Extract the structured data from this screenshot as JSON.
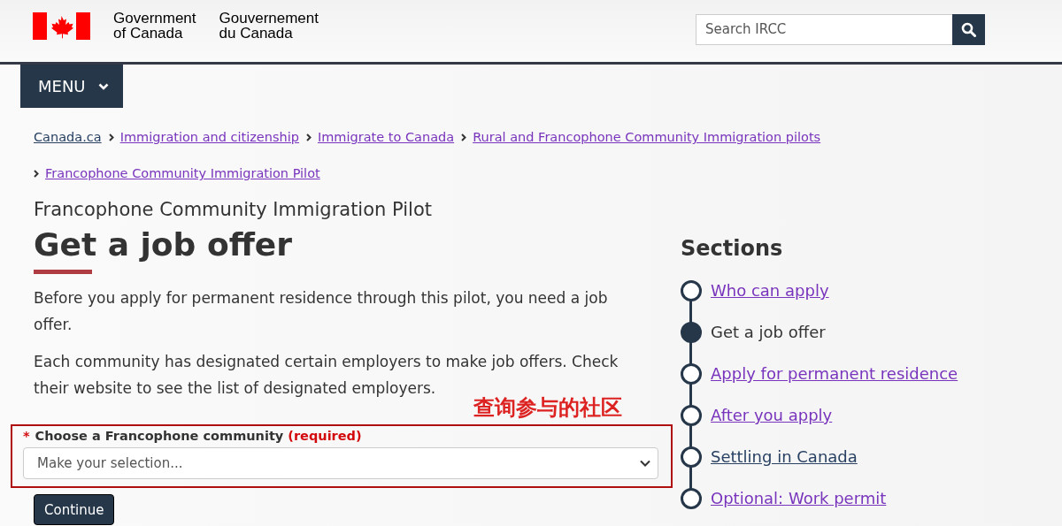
{
  "header": {
    "wordmark_en": [
      "Government",
      "of Canada"
    ],
    "wordmark_fr": [
      "Gouvernement",
      "du Canada"
    ],
    "search": {
      "placeholder": "Search IRCC"
    }
  },
  "menu": {
    "label": "MENU"
  },
  "breadcrumbs": [
    {
      "label": "Canada.ca",
      "visited": false
    },
    {
      "label": "Immigration and citizenship",
      "visited": true
    },
    {
      "label": "Immigrate to Canada",
      "visited": true
    },
    {
      "label": "Rural and Francophone Community Immigration pilots",
      "visited": true
    },
    {
      "label": "Francophone Community Immigration Pilot",
      "visited": true
    }
  ],
  "page": {
    "kicker": "Francophone Community Immigration Pilot",
    "title": "Get a job offer",
    "paragraphs": [
      "Before you apply for permanent residence through this pilot, you need a job offer.",
      "Each community has designated certain employers to make job offers. Check their website to see the list of designated employers."
    ],
    "annotation": "查询参与的社区",
    "form": {
      "highlighted": true,
      "label": "Choose a Francophone community",
      "required_marker": "*",
      "required_text": "(required)",
      "select": {
        "value": "Make your selection..."
      },
      "button": "Continue"
    }
  },
  "sections": {
    "title": "Sections",
    "items": [
      {
        "label": "Who can apply",
        "selected": false,
        "visited": true
      },
      {
        "label": "Get a job offer",
        "selected": true
      },
      {
        "label": "Apply for permanent residence",
        "selected": false,
        "visited": true
      },
      {
        "label": "After you apply",
        "selected": false,
        "visited": true
      },
      {
        "label": "Settling in Canada",
        "selected": false,
        "visited": false
      },
      {
        "label": "Optional: Work permit",
        "selected": false,
        "visited": true
      }
    ]
  }
}
